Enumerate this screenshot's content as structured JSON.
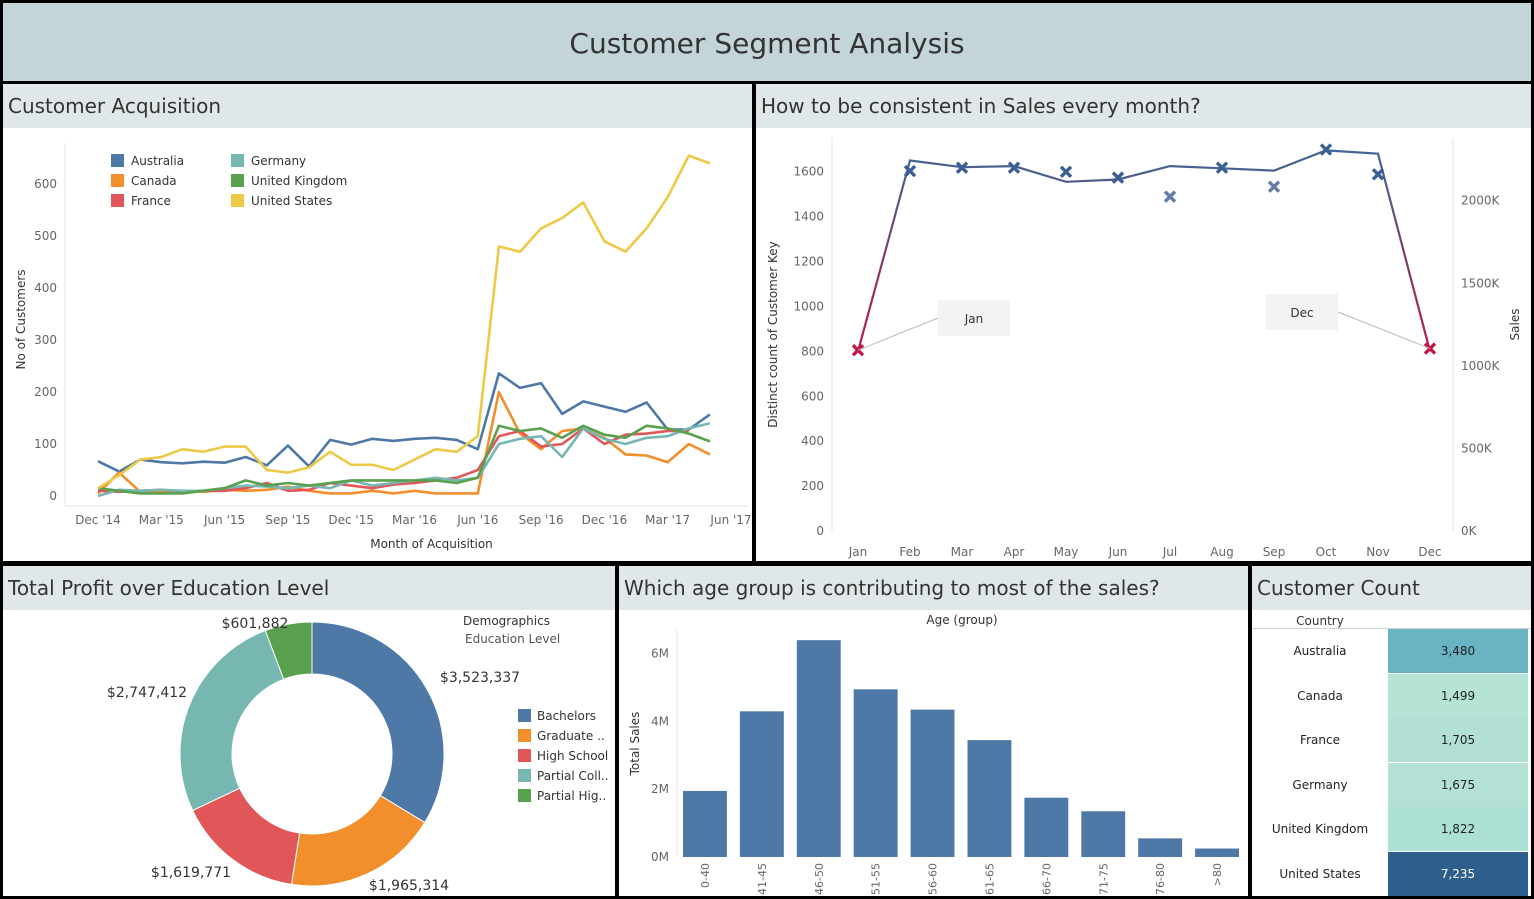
{
  "dashboard_title": "Customer Segment Analysis",
  "panels": {
    "acquisition": {
      "title": "Customer Acquisition"
    },
    "monthly": {
      "title": "How to be consistent in Sales every month?"
    },
    "education": {
      "title": "Total Profit over Education Level"
    },
    "age": {
      "title": "Which age group is contributing to most of the sales?"
    },
    "count": {
      "title": "Customer Count"
    }
  },
  "chart_data": [
    {
      "id": "acquisition",
      "type": "line",
      "xlabel": "Month of Acquisition",
      "ylabel": "No of Customers",
      "ylim": [
        0,
        660
      ],
      "yticks": [
        0,
        100,
        200,
        300,
        400,
        500,
        600
      ],
      "x_tick_labels": [
        "Dec '14",
        "Mar '15",
        "Jun '15",
        "Sep '15",
        "Dec '15",
        "Mar '16",
        "Jun '16",
        "Sep '16",
        "Dec '16",
        "Mar '17",
        "Jun '17"
      ],
      "x": [
        "Dec '14",
        "Jan '15",
        "Feb '15",
        "Mar '15",
        "Apr '15",
        "May '15",
        "Jun '15",
        "Jul '15",
        "Aug '15",
        "Sep '15",
        "Oct '15",
        "Nov '15",
        "Dec '15",
        "Jan '16",
        "Feb '16",
        "Mar '16",
        "Apr '16",
        "May '16",
        "Jun '16",
        "Jul '16",
        "Aug '16",
        "Sep '16",
        "Oct '16",
        "Nov '16",
        "Dec '16",
        "Jan '17",
        "Feb '17",
        "Mar '17",
        "Apr '17",
        "May '17",
        "Jun '17"
      ],
      "legend_placement": "top-left",
      "series": [
        {
          "name": "Australia",
          "color": "#4e79a7",
          "values": [
            67,
            47,
            70,
            65,
            63,
            66,
            64,
            75,
            59,
            97,
            57,
            108,
            99,
            110,
            106,
            110,
            112,
            108,
            90,
            236,
            208,
            217,
            158,
            182,
            172,
            162,
            180,
            128,
            128,
            157,
            null
          ]
        },
        {
          "name": "Canada",
          "color": "#f28e2b",
          "values": [
            5,
            45,
            8,
            7,
            10,
            8,
            12,
            10,
            12,
            18,
            10,
            5,
            5,
            10,
            5,
            10,
            5,
            5,
            5,
            200,
            120,
            90,
            125,
            130,
            112,
            80,
            78,
            65,
            100,
            80,
            null
          ]
        },
        {
          "name": "France",
          "color": "#e15759",
          "values": [
            10,
            8,
            10,
            12,
            8,
            10,
            10,
            15,
            25,
            10,
            12,
            25,
            20,
            15,
            22,
            25,
            30,
            35,
            50,
            115,
            125,
            95,
            100,
            130,
            100,
            118,
            120,
            125,
            125,
            null,
            null
          ]
        },
        {
          "name": "Germany",
          "color": "#76b7b2",
          "values": [
            0,
            12,
            10,
            12,
            10,
            10,
            15,
            20,
            18,
            15,
            20,
            15,
            30,
            20,
            25,
            30,
            35,
            30,
            35,
            100,
            110,
            115,
            75,
            130,
            110,
            100,
            112,
            115,
            130,
            140,
            null
          ]
        },
        {
          "name": "United Kingdom",
          "color": "#59a14f",
          "values": [
            15,
            10,
            5,
            5,
            5,
            10,
            15,
            30,
            20,
            25,
            20,
            25,
            30,
            30,
            30,
            30,
            30,
            25,
            35,
            135,
            125,
            130,
            112,
            135,
            118,
            112,
            135,
            130,
            120,
            105,
            null
          ]
        },
        {
          "name": "United States",
          "color": "#edc948",
          "values": [
            15,
            40,
            70,
            75,
            90,
            85,
            95,
            95,
            50,
            45,
            55,
            85,
            60,
            60,
            50,
            70,
            90,
            85,
            115,
            480,
            470,
            515,
            535,
            565,
            490,
            470,
            515,
            575,
            655,
            640,
            null
          ]
        }
      ]
    },
    {
      "id": "monthly",
      "type": "line",
      "xlabel": "",
      "ylabel": "Distinct count of Customer Key",
      "y2label": "Sales",
      "categories": [
        "Jan",
        "Feb",
        "Mar",
        "Apr",
        "May",
        "Jun",
        "Jul",
        "Aug",
        "Sep",
        "Oct",
        "Nov",
        "Dec"
      ],
      "ylim": [
        0,
        1750
      ],
      "yticks": [
        0,
        200,
        400,
        600,
        800,
        1000,
        1200,
        1400,
        1600
      ],
      "y2lim": [
        0,
        2380000
      ],
      "y2ticks": [
        "0K",
        "500K",
        "1000K",
        "1500K",
        "2000K"
      ],
      "series": [
        {
          "name": "Distinct count of Customer Key",
          "values": [
            800,
            1650,
            1620,
            1625,
            1555,
            1565,
            1625,
            1615,
            1605,
            1695,
            1680,
            800
          ]
        },
        {
          "name": "Sales",
          "values": [
            1095000,
            2180000,
            2200000,
            2200000,
            2175000,
            2140000,
            2025000,
            2200000,
            2085000,
            2310000,
            2160000,
            1105000
          ]
        }
      ],
      "annotations": [
        {
          "text": "Jan",
          "target": "Jan"
        },
        {
          "text": "Dec",
          "target": "Dec"
        }
      ],
      "colors": {
        "line_top": "#3f6798",
        "line_bottom": "#b81a44",
        "mark": "#3b5f93",
        "mark_low": "#c2184a"
      }
    },
    {
      "id": "education",
      "type": "pie",
      "legend_title": "Demographics",
      "legend_subtitle": "Education Level",
      "legend_placement": "right",
      "slices": [
        {
          "label": "Bachelors",
          "value": 3523337,
          "value_label": "$3,523,337",
          "color": "#4e79a7"
        },
        {
          "label": "Graduate ..",
          "value": 1965314,
          "value_label": "$1,965,314",
          "color": "#f28e2b"
        },
        {
          "label": "High School",
          "value": 1619771,
          "value_label": "$1,619,771",
          "color": "#e15759"
        },
        {
          "label": "Partial Coll..",
          "value": 2747412,
          "value_label": "$2,747,412",
          "color": "#76b7b2"
        },
        {
          "label": "Partial Hig..",
          "value": 601882,
          "value_label": "$601,882",
          "color": "#59a14f"
        }
      ]
    },
    {
      "id": "age",
      "type": "bar",
      "title": "Age (group)",
      "ylabel": "Total Sales",
      "categories": [
        "0-40",
        "41-45",
        "46-50",
        "51-55",
        "56-60",
        "61-65",
        "66-70",
        "71-75",
        "76-80",
        ">80"
      ],
      "values": [
        1950000,
        4300000,
        6400000,
        4950000,
        4350000,
        3450000,
        1750000,
        1350000,
        550000,
        250000
      ],
      "ylim": [
        0,
        6700000
      ],
      "yticks": [
        "0M",
        "2M",
        "4M",
        "6M"
      ],
      "color": "#4e79a7"
    },
    {
      "id": "count",
      "type": "table",
      "column_header": "Country",
      "rows": [
        {
          "country": "Australia",
          "value": "3,480",
          "color": "#68b4c3"
        },
        {
          "country": "Canada",
          "value": "1,499",
          "color": "#b5e3d6"
        },
        {
          "country": "France",
          "value": "1,705",
          "color": "#b2e0d5"
        },
        {
          "country": "Germany",
          "value": "1,675",
          "color": "#b3e1d5"
        },
        {
          "country": "United Kingdom",
          "value": "1,822",
          "color": "#ade0d4"
        },
        {
          "country": "United States",
          "value": "7,235",
          "color": "#2d5e8c"
        }
      ]
    }
  ]
}
